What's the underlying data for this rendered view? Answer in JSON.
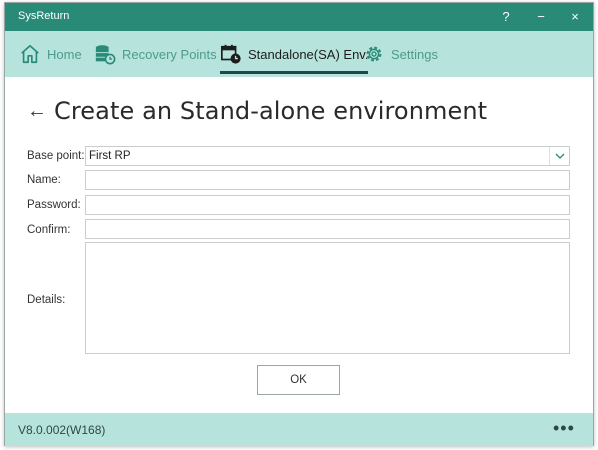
{
  "window": {
    "title": "SysReturn",
    "help_glyph": "?",
    "minimize_glyph": "−",
    "close_glyph": "×"
  },
  "nav": {
    "items": [
      {
        "label": "Home",
        "icon": "home-icon",
        "active": false
      },
      {
        "label": "Recovery Points",
        "icon": "database-restore-icon",
        "active": false
      },
      {
        "label": "Standalone(SA) Env.",
        "icon": "calendar-clock-icon",
        "active": true
      },
      {
        "label": "Settings",
        "icon": "gear-icon",
        "active": false
      }
    ]
  },
  "page": {
    "back_glyph": "←",
    "title": "Create an Stand-alone environment"
  },
  "form": {
    "base_point_label": "Base point:",
    "base_point_value": "First RP",
    "name_label": "Name:",
    "name_value": "",
    "password_label": "Password:",
    "password_value": "",
    "confirm_label": "Confirm:",
    "confirm_value": "",
    "details_label": "Details:",
    "details_value": "",
    "ok_label": "OK"
  },
  "status": {
    "version": "V8.0.002(W168)",
    "more_glyph": "•••"
  },
  "colors": {
    "titlebar": "#2a8a78",
    "navbar": "#b6e4dc",
    "nav_text": "#4f9a8d",
    "active_underline": "#1d4a44"
  }
}
